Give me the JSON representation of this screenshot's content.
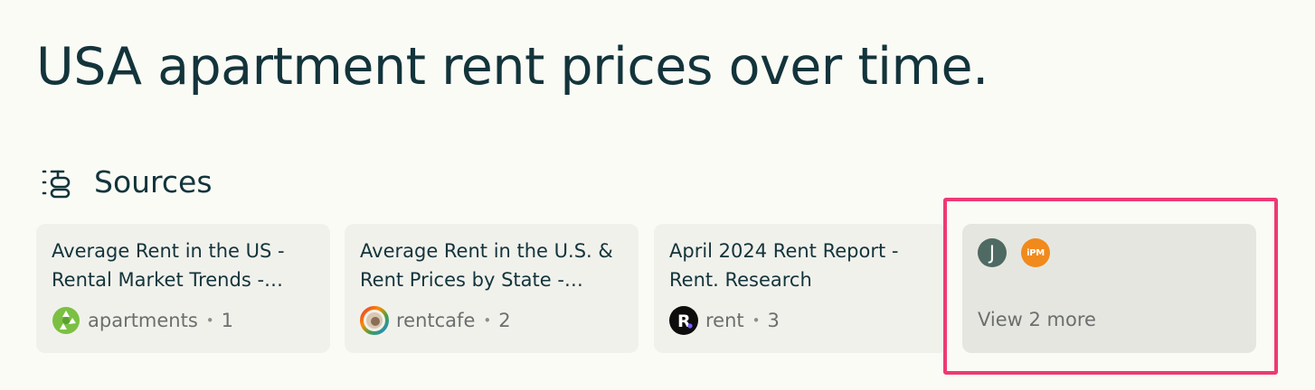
{
  "query": {
    "title": "USA apartment rent prices over time."
  },
  "sources": {
    "heading": "Sources",
    "icon": "sources-list-icon",
    "items": [
      {
        "title": "Average Rent in the US - Rental Market Trends - Apartments.com",
        "site": "apartments",
        "index": "1",
        "favicon": "apartments-favicon"
      },
      {
        "title": "Average Rent in the U.S. & Rent Prices by State - RentCafe",
        "site": "rentcafe",
        "index": "2",
        "favicon": "rentcafe-favicon"
      },
      {
        "title": "April 2024 Rent Report - Rent. Research",
        "site": "rent",
        "index": "3",
        "favicon": "rent-favicon"
      }
    ],
    "more": {
      "icon_letter": "J",
      "icon_badge": "iPM",
      "label": "View 2 more"
    }
  },
  "colors": {
    "background": "#fbfbf6",
    "card": "#f1f1ec",
    "text": "#13343b",
    "muted": "#6b6f6d",
    "highlight": "#ee3a74"
  }
}
